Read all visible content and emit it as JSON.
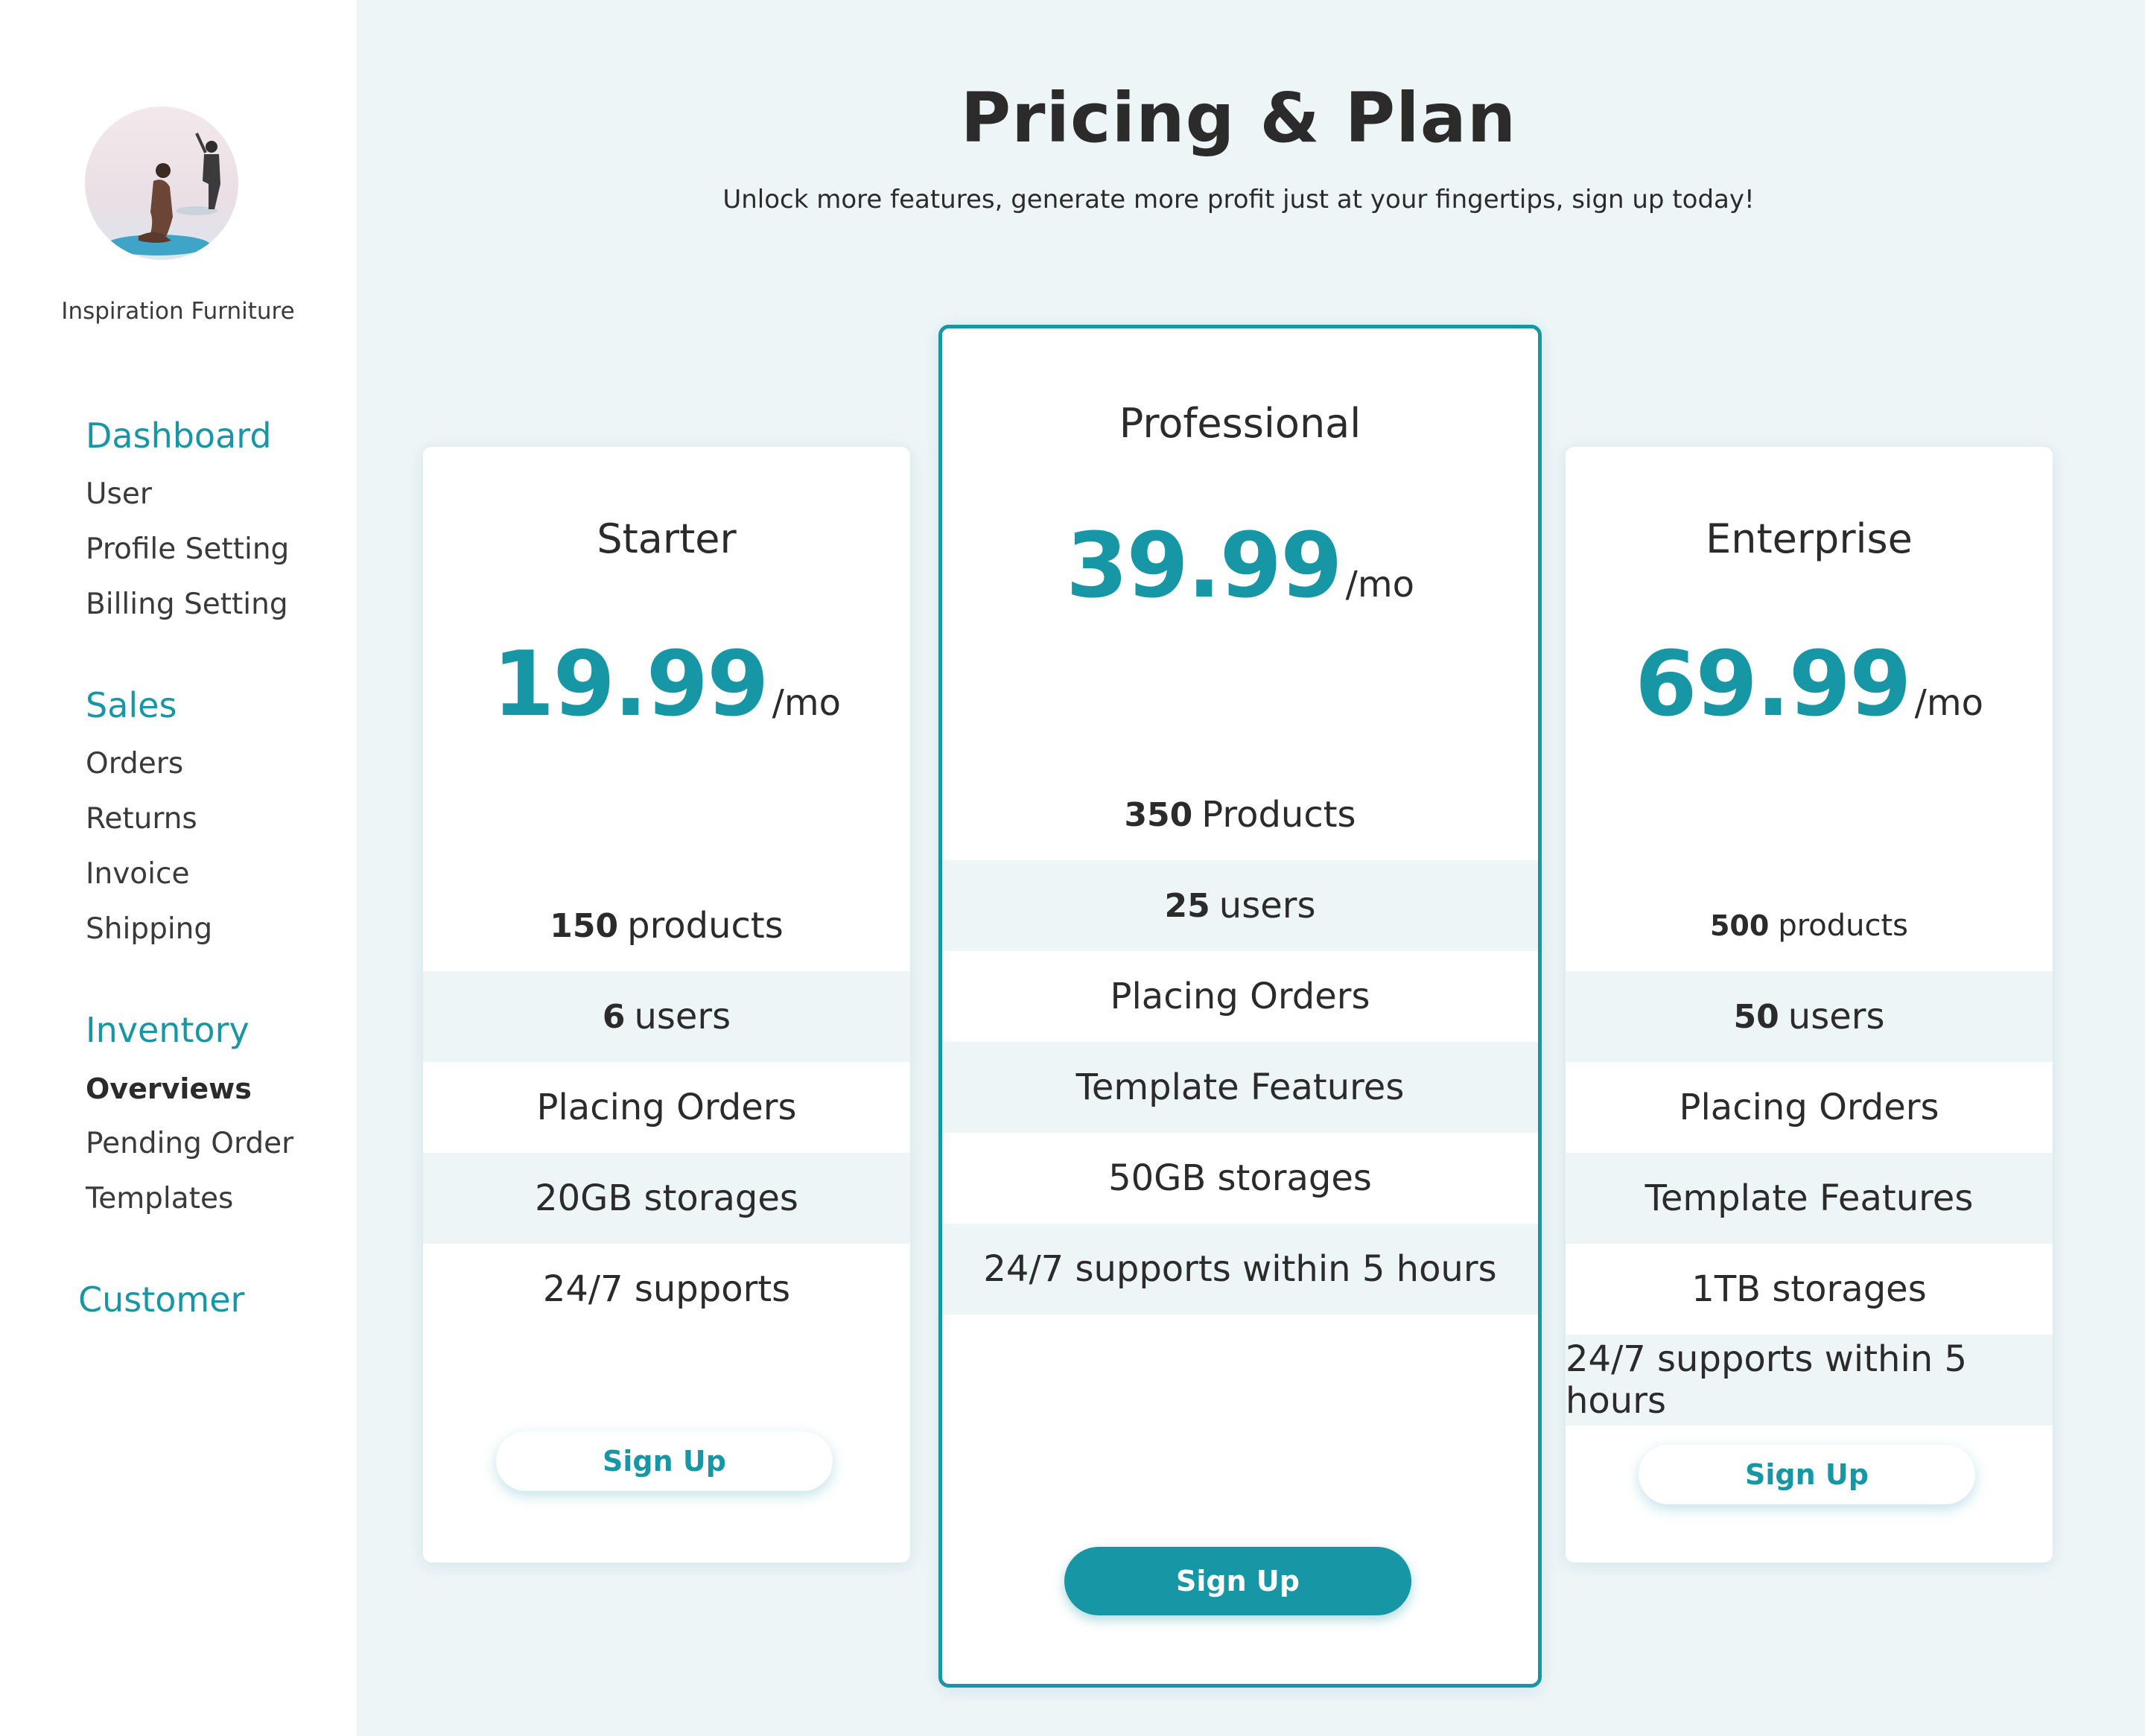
{
  "sidebar": {
    "company_name": "Inspiration Furniture",
    "groups": [
      {
        "heading": "Dashboard",
        "items": [
          "User",
          "Profile Setting",
          "Billing Setting"
        ]
      },
      {
        "heading": "Sales",
        "items": [
          "Orders",
          "Returns",
          "Invoice",
          "Shipping"
        ]
      },
      {
        "heading": "Inventory",
        "items": [
          "Overviews",
          "Pending Order",
          "Templates"
        ],
        "active_item": "Overviews"
      },
      {
        "heading": "Customer",
        "items": []
      }
    ]
  },
  "header": {
    "title": "Pricing & Plan",
    "subtitle": "Unlock more features, generate more profit just at your fingertips, sign up today!"
  },
  "plans": [
    {
      "name": "Starter",
      "price": "19.99",
      "period": "/mo",
      "features": [
        {
          "bold": "150",
          "text": "products"
        },
        {
          "bold": "6",
          "text": "users"
        },
        {
          "bold": "",
          "text": "Placing Orders"
        },
        {
          "bold": "",
          "text": "20GB storages"
        },
        {
          "bold": "",
          "text": "24/7 supports"
        }
      ],
      "button": "Sign Up"
    },
    {
      "name": "Professional",
      "price": "39.99",
      "period": "/mo",
      "features": [
        {
          "bold": "350",
          "text": "Products"
        },
        {
          "bold": "25",
          "text": "users"
        },
        {
          "bold": "",
          "text": "Placing Orders"
        },
        {
          "bold": "",
          "text": "Template Features"
        },
        {
          "bold": "",
          "text": "50GB storages"
        },
        {
          "bold": "",
          "text": "24/7 supports within 5 hours"
        }
      ],
      "button": "Sign Up"
    },
    {
      "name": "Enterprise",
      "price": "69.99",
      "period": "/mo",
      "features": [
        {
          "bold": "500",
          "text": "products"
        },
        {
          "bold": "50",
          "text": "users"
        },
        {
          "bold": "",
          "text": "Placing Orders"
        },
        {
          "bold": "",
          "text": "Template Features"
        },
        {
          "bold": "",
          "text": "1TB storages"
        },
        {
          "bold": "",
          "text": "24/7 supports within 5 hours"
        }
      ],
      "button": "Sign Up"
    }
  ],
  "colors": {
    "accent": "#1796a6",
    "background": "#eef5f7",
    "text": "#2b2b2b"
  }
}
